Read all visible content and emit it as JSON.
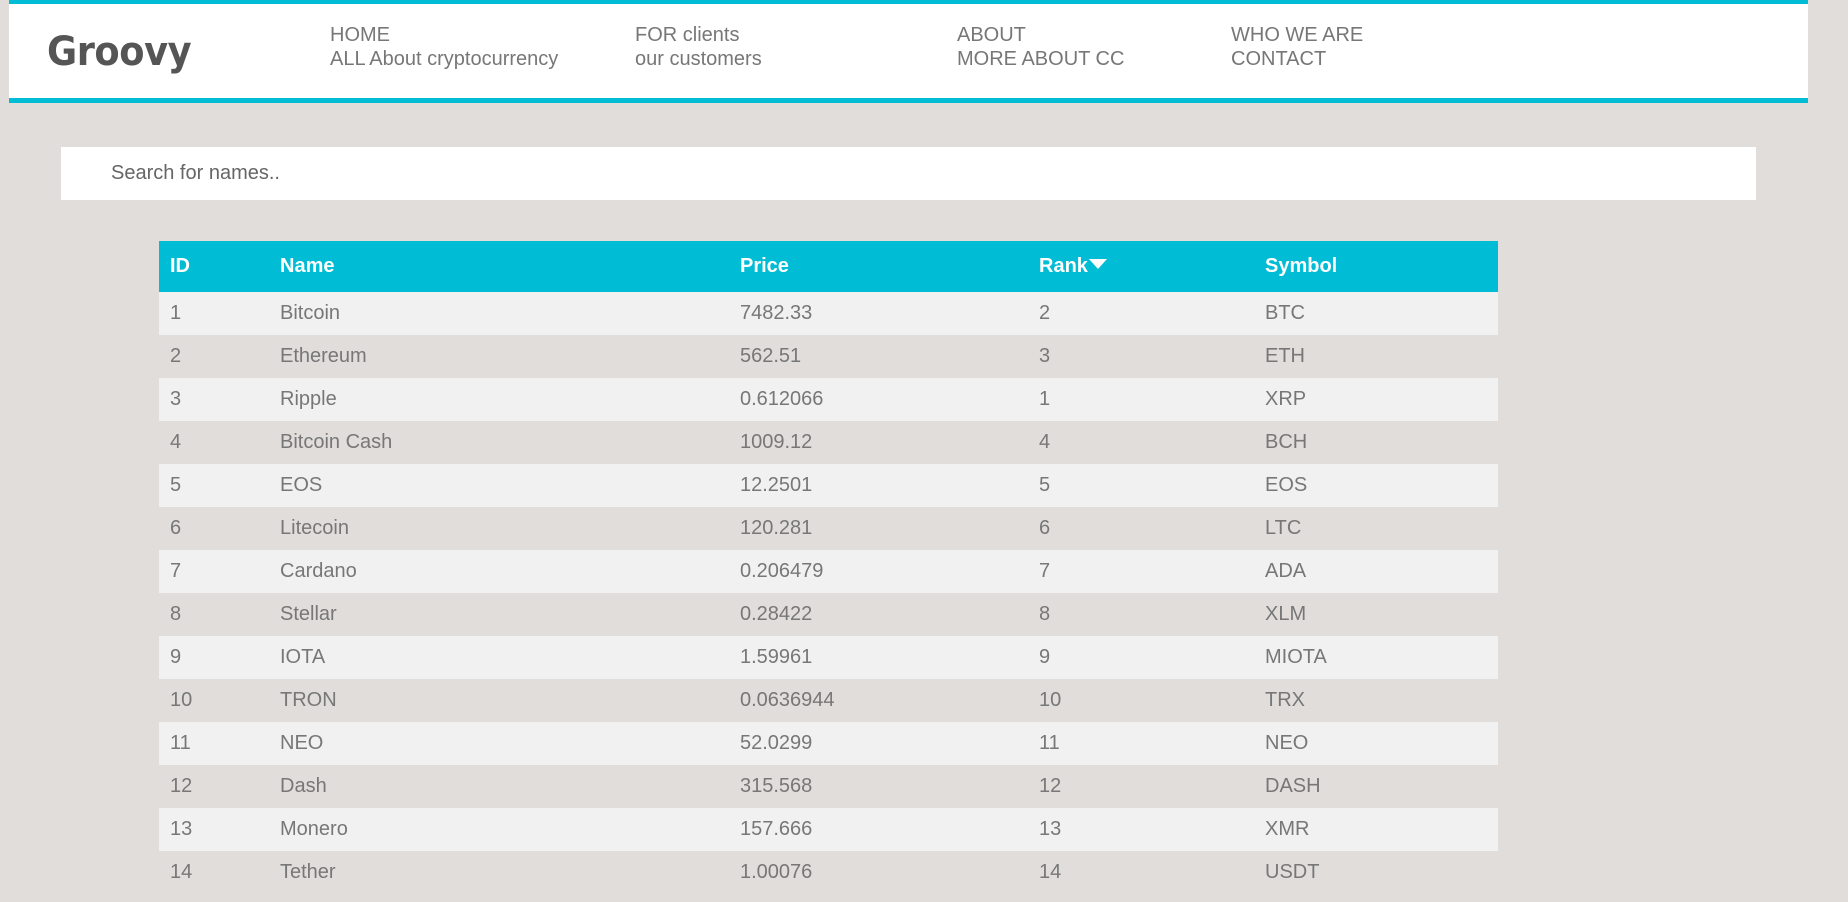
{
  "header": {
    "logo": "Groovy",
    "nav": [
      {
        "line1": "HOME",
        "line2": "ALL About cryptocurrency"
      },
      {
        "line1": "FOR clients",
        "line2": "our customers"
      },
      {
        "line1": "ABOUT",
        "line2": "MORE ABOUT CC"
      },
      {
        "line1": "WHO WE ARE",
        "line2": "CONTACT"
      }
    ]
  },
  "search": {
    "placeholder": "Search for names..",
    "value": ""
  },
  "table": {
    "columns": [
      "ID",
      "Name",
      "Price",
      "Rank",
      "Symbol"
    ],
    "sorted_column": "Rank",
    "sort_direction": "descending",
    "rows": [
      [
        "1",
        "Bitcoin",
        "7482.33",
        "2",
        "BTC"
      ],
      [
        "2",
        "Ethereum",
        "562.51",
        "3",
        "ETH"
      ],
      [
        "3",
        "Ripple",
        "0.612066",
        "1",
        "XRP"
      ],
      [
        "4",
        "Bitcoin Cash",
        "1009.12",
        "4",
        "BCH"
      ],
      [
        "5",
        "EOS",
        "12.2501",
        "5",
        "EOS"
      ],
      [
        "6",
        "Litecoin",
        "120.281",
        "6",
        "LTC"
      ],
      [
        "7",
        "Cardano",
        "0.206479",
        "7",
        "ADA"
      ],
      [
        "8",
        "Stellar",
        "0.28422",
        "8",
        "XLM"
      ],
      [
        "9",
        "IOTA",
        "1.59961",
        "9",
        "MIOTA"
      ],
      [
        "10",
        "TRON",
        "0.0636944",
        "10",
        "TRX"
      ],
      [
        "11",
        "NEO",
        "52.0299",
        "11",
        "NEO"
      ],
      [
        "12",
        "Dash",
        "315.568",
        "12",
        "DASH"
      ],
      [
        "13",
        "Monero",
        "157.666",
        "13",
        "XMR"
      ],
      [
        "14",
        "Tether",
        "1.00076",
        "14",
        "USDT"
      ]
    ]
  },
  "colors": {
    "accent": "#00bcd4",
    "background": "#e0dddb",
    "row_light": "#f1f1f1",
    "text": "#777777"
  }
}
